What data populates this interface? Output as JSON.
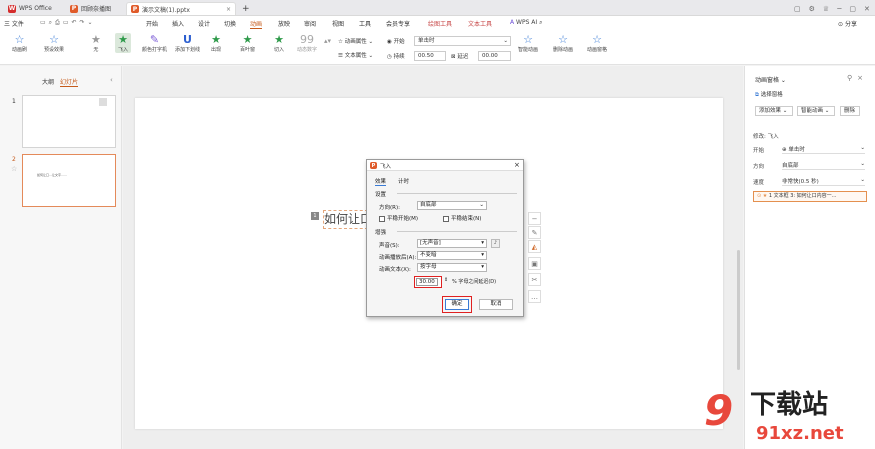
{
  "tabs": [
    {
      "label": "WPS Office"
    },
    {
      "label": "回顾奈播图"
    },
    {
      "label": "演示文稿(1).pptx"
    }
  ],
  "tab_add": "+",
  "window_controls": [
    "▢",
    "⚙",
    "♕",
    "─",
    "▢",
    "✕"
  ],
  "menu": {
    "file": "三 文件",
    "items": [
      "开始",
      "插入",
      "设计",
      "切换",
      "动画",
      "放映",
      "审阅",
      "视图",
      "工具",
      "会员专享"
    ],
    "active": "动画",
    "context_items": [
      "绘图工具",
      "文本工具"
    ],
    "wps_ai": "WPS AI",
    "share": "分享"
  },
  "ribbon": {
    "buttons": [
      {
        "label": "动画刷"
      },
      {
        "label": "预设效果"
      },
      {
        "label": "无"
      },
      {
        "label": "飞入"
      },
      {
        "label": "颜色打字机"
      },
      {
        "label": "添加下划线"
      },
      {
        "label": "出现"
      },
      {
        "label": "百叶窗"
      },
      {
        "label": "切入"
      },
      {
        "label": "动态数字"
      }
    ],
    "attr1": "动画属性",
    "attr2": "文本属性",
    "start_label": "开始",
    "start_value": "单击时",
    "dur_label": "持续",
    "dur_value": "00.50",
    "delay_label": "延迟",
    "delay_value": "00.00",
    "right_buttons": [
      {
        "label": "智能动画"
      },
      {
        "label": "删除动画"
      },
      {
        "label": "动画窗格"
      }
    ]
  },
  "left_panel": {
    "tab_outline": "大纲",
    "tab_slides": "幻灯片",
    "slides": [
      {
        "num": "1"
      },
      {
        "num": "2",
        "text": "如何让口…让文字……"
      }
    ]
  },
  "slide": {
    "badge": "1",
    "text": "如何让口"
  },
  "dialog": {
    "title": "飞入",
    "tab_effect": "效果",
    "tab_timing": "计时",
    "group_settings": "设置",
    "direction_label": "方向(R):",
    "direction_value": "自底部",
    "smooth_start": "平稳开始(M)",
    "smooth_end": "平稳结束(N)",
    "group_enhance": "增强",
    "sound_label": "声音(S):",
    "sound_value": "[无声音]",
    "after_label": "动画播放后(A):",
    "after_value": "不变暗",
    "text_label": "动画文本(X):",
    "text_value": "按字母",
    "pct_value": "30.00",
    "pct_label": "% 字母之间延迟(D)",
    "ok": "确定",
    "cancel": "取消"
  },
  "right_panel": {
    "title": "动画窗格",
    "select_pane": "选择窗格",
    "add_effect": "添加效果",
    "smart": "智能动画",
    "delete": "删除",
    "modify": "修改: 飞入",
    "start_label": "开始",
    "start_value": "单击时",
    "dir_label": "方向",
    "dir_value": "自底部",
    "speed_label": "速度",
    "speed_value": "非常快(0.5 秒)",
    "anim_item": "1 文本框 3: 如何让口内容一..."
  },
  "watermark": {
    "big": "下载站",
    "url": "91xz.net",
    "num": "9"
  }
}
